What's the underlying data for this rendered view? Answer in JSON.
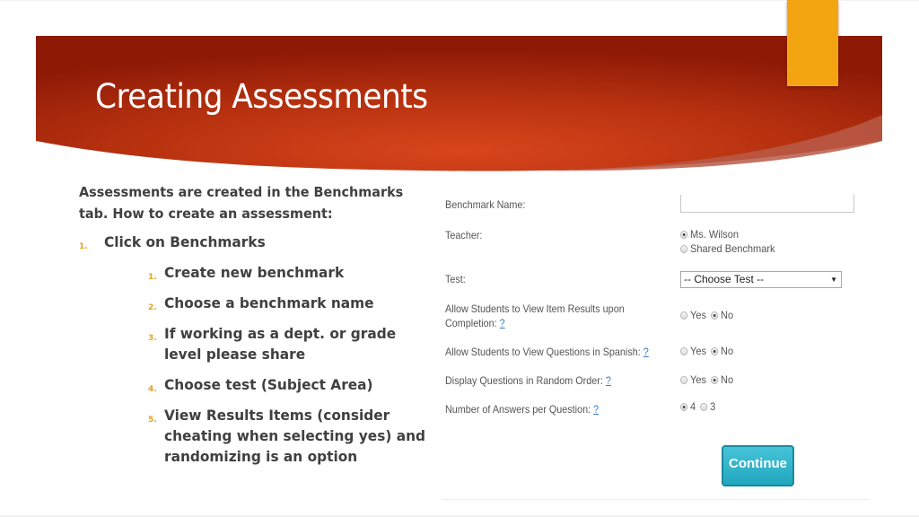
{
  "slide": {
    "title": "Creating Assessments",
    "colors": {
      "banner_dark": "#8e1a06",
      "banner_light": "#d8461c",
      "accent": "#f3a511",
      "number_color": "#e8a020",
      "continue_button": "#2fb3cb"
    },
    "intro": "Assessments are created in the Benchmarks tab. How to create an assessment:",
    "steps": [
      {
        "num": "1.",
        "text": "Click on Benchmarks"
      },
      {
        "num": "1.",
        "text": "Create new benchmark"
      },
      {
        "num": "2.",
        "text": "Choose a benchmark name"
      },
      {
        "num": "3.",
        "text": "If working as a dept. or grade level please share"
      },
      {
        "num": "4.",
        "text": "Choose test (Subject Area)"
      },
      {
        "num": "5.",
        "text": "View Results Items (consider cheating when selecting yes) and randomizing is an option"
      }
    ]
  },
  "form": {
    "benchmark_name": {
      "label": "Benchmark Name:",
      "value": ""
    },
    "teacher": {
      "label": "Teacher:",
      "options": [
        {
          "label": "Ms. Wilson",
          "selected": true
        },
        {
          "label": "Shared Benchmark",
          "selected": false
        }
      ]
    },
    "test": {
      "label": "Test:",
      "selected": "-- Choose Test --",
      "arrow": "▼"
    },
    "view_item_results": {
      "label_line1": "Allow Students to View Item Results upon",
      "label_line2": "Completion:",
      "help": "?",
      "options": [
        {
          "label": "Yes",
          "selected": false
        },
        {
          "label": "No",
          "selected": true
        }
      ]
    },
    "view_spanish": {
      "label": "Allow Students to View Questions in Spanish:",
      "help": "?",
      "options": [
        {
          "label": "Yes",
          "selected": false
        },
        {
          "label": "No",
          "selected": true
        }
      ]
    },
    "random_order": {
      "label": "Display Questions in Random Order:",
      "help": "?",
      "options": [
        {
          "label": "Yes",
          "selected": false
        },
        {
          "label": "No",
          "selected": true
        }
      ]
    },
    "answers_per_question": {
      "label": "Number of Answers per Question:",
      "help": "?",
      "options": [
        {
          "label": "4",
          "selected": true
        },
        {
          "label": "3",
          "selected": false
        }
      ]
    },
    "continue_label": "Continue"
  }
}
